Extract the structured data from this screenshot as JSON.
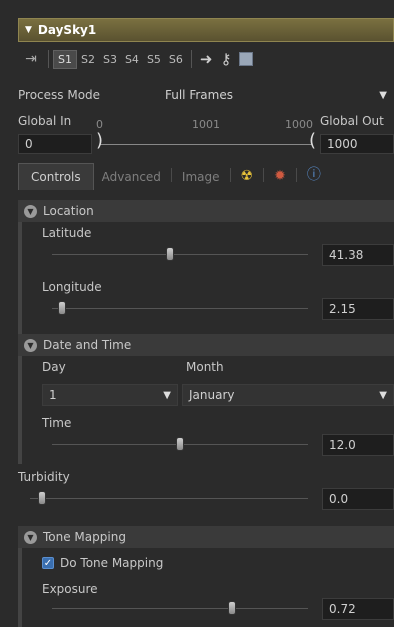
{
  "tool": {
    "name": "DaySky1"
  },
  "toolbar": {
    "slots": [
      "S1",
      "S2",
      "S3",
      "S4",
      "S5",
      "S6"
    ]
  },
  "process_mode": {
    "label": "Process Mode",
    "value": "Full Frames"
  },
  "range": {
    "global_in_label": "Global In",
    "global_in_value": "0",
    "global_out_label": "Global Out",
    "global_out_value": "1000",
    "ticks": [
      "0",
      "1001",
      "1000"
    ]
  },
  "tabs": [
    "Controls",
    "Advanced",
    "Image"
  ],
  "location": {
    "title": "Location",
    "latitude_label": "Latitude",
    "latitude_value": "41.38",
    "longitude_label": "Longitude",
    "longitude_value": "2.15"
  },
  "datetime": {
    "title": "Date and Time",
    "day_label": "Day",
    "day_value": "1",
    "month_label": "Month",
    "month_value": "January",
    "time_label": "Time",
    "time_value": "12.0"
  },
  "turbidity": {
    "label": "Turbidity",
    "value": "0.0"
  },
  "tonemap": {
    "title": "Tone Mapping",
    "do_label": "Do Tone Mapping",
    "exposure_label": "Exposure",
    "exposure_value": "0.72"
  }
}
